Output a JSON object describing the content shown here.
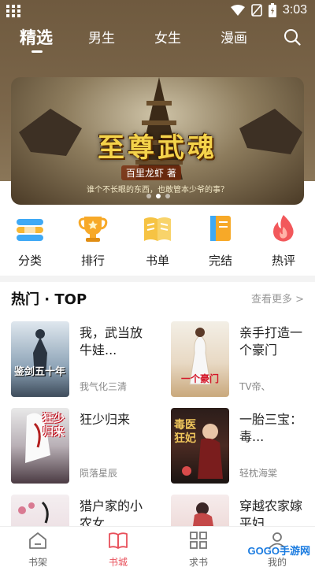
{
  "statusbar": {
    "time": "3:03"
  },
  "tabs": [
    {
      "label": "精选",
      "active": true
    },
    {
      "label": "男生"
    },
    {
      "label": "女生"
    },
    {
      "label": "漫画"
    }
  ],
  "banner": {
    "title": "至尊武魂",
    "author": "百里龙虾 著",
    "tagline": "谁个不长眼的东西，也敢管本少爷的事？",
    "slides": 3,
    "active_slide": 1
  },
  "categories": [
    {
      "label": "分类",
      "icon": "category-icon"
    },
    {
      "label": "排行",
      "icon": "trophy-icon"
    },
    {
      "label": "书单",
      "icon": "open-book-icon"
    },
    {
      "label": "完结",
      "icon": "finished-book-icon"
    },
    {
      "label": "热评",
      "icon": "flame-icon"
    }
  ],
  "section": {
    "title": "热门 · TOP",
    "more": "查看更多 >"
  },
  "books": [
    {
      "name": "我，武当放牛娃...",
      "author": "我气化三清",
      "cover_text": "鉴剑五十年"
    },
    {
      "name": "亲手打造一个豪门",
      "author": "TV帝、",
      "cover_text": "一个豪门"
    },
    {
      "name": "狂少归来",
      "author": "陨落星辰",
      "cover_text": "狂少归来"
    },
    {
      "name": "一胎三宝：毒...",
      "author": "轻枕海棠",
      "cover_text": "毒医狂妃"
    },
    {
      "name": "猎户家的小农女",
      "author": "",
      "cover_text": ""
    },
    {
      "name": "穿越农家嫁平妇",
      "author": "",
      "cover_text": ""
    }
  ],
  "bottom_nav": [
    {
      "label": "书架",
      "icon": "bookshelf-icon"
    },
    {
      "label": "书城",
      "icon": "bookstore-icon",
      "active": true
    },
    {
      "label": "求书",
      "icon": "grid-request-icon"
    },
    {
      "label": "我的",
      "icon": "profile-icon"
    }
  ],
  "watermark": "GOGO手游网",
  "colors": {
    "header": "#7b664a",
    "accent": "#e8505b"
  }
}
